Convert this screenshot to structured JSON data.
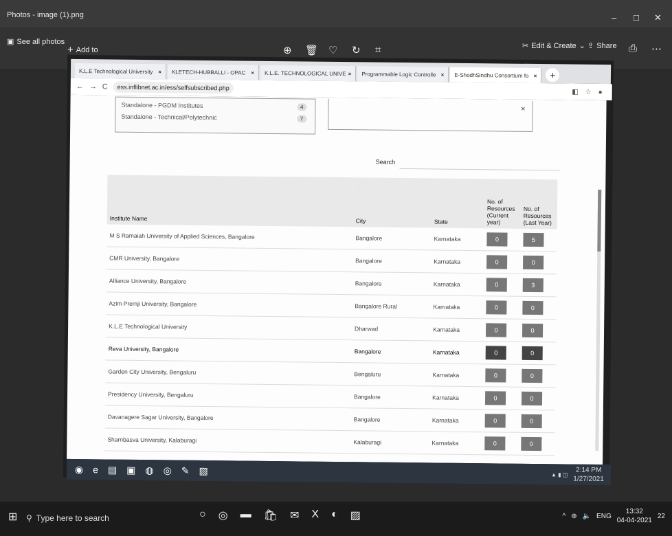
{
  "photos": {
    "title": "Photos - image (1).png",
    "see_all": "See all photos",
    "add_to": "Add to",
    "edit_create": "Edit & Create",
    "share": "Share"
  },
  "browser": {
    "tabs": [
      {
        "label": "K.L.E Technological University"
      },
      {
        "label": "KLETECH-HUBBALLI - OPAC"
      },
      {
        "label": "K.L.E. TECHNOLOGICAL UNIVE"
      },
      {
        "label": "Programmable Logic Controlle"
      },
      {
        "label": "E-ShodhSindhu Consortium fo"
      }
    ],
    "url": "ess.inflibnet.ac.in/ess/selfsubscribed.php"
  },
  "filters": [
    {
      "label": "Standalone - PGDM Institutes",
      "count": "4"
    },
    {
      "label": "Standalone - Technical/Polytechnic",
      "count": "7"
    }
  ],
  "search_label": "Search",
  "table": {
    "headers": {
      "name": "Institute Name",
      "city": "City",
      "state": "State",
      "current": "No. of Resources (Current year)",
      "last": "No. of Resources (Last Year)"
    },
    "rows": [
      {
        "name": "M S Ramaiah University of Applied Sciences, Bangalore",
        "city": "Bangalore",
        "state": "Karnataka",
        "current": "0",
        "last": "5"
      },
      {
        "name": "CMR University, Bangalore",
        "city": "Bangalore",
        "state": "Karnataka",
        "current": "0",
        "last": "0"
      },
      {
        "name": "Alliance University, Bangalore",
        "city": "Bangalore",
        "state": "Karnataka",
        "current": "0",
        "last": "3"
      },
      {
        "name": "Azim Premji University, Bangalore",
        "city": "Bangalore Rural",
        "state": "Karnataka",
        "current": "0",
        "last": "0"
      },
      {
        "name": "K.L.E Technological University",
        "city": "Dharwad",
        "state": "Karnataka",
        "current": "0",
        "last": "0"
      },
      {
        "name": "Reva University, Bangalore",
        "city": "Bangalore",
        "state": "Karnataka",
        "current": "0",
        "last": "0"
      },
      {
        "name": "Garden City University, Bengaluru",
        "city": "Bengaluru",
        "state": "Karnataka",
        "current": "0",
        "last": "0"
      },
      {
        "name": "Presidency University, Bengaluru",
        "city": "Bangalore",
        "state": "Karnataka",
        "current": "0",
        "last": "0"
      },
      {
        "name": "Davanagere Sagar University, Bangalore",
        "city": "Bangalore",
        "state": "Karnataka",
        "current": "0",
        "last": "0"
      },
      {
        "name": "Sharnbasva University, Kalaburagi",
        "city": "Kalaburagi",
        "state": "Karnataka",
        "current": "0",
        "last": "0"
      }
    ]
  },
  "inner_clock": {
    "time": "2:14 PM",
    "date": "1/27/2021"
  },
  "taskbar": {
    "search_placeholder": "Type here to search",
    "lang": "ENG",
    "time": "13:32",
    "date": "04-04-2021",
    "notifications": "22"
  }
}
